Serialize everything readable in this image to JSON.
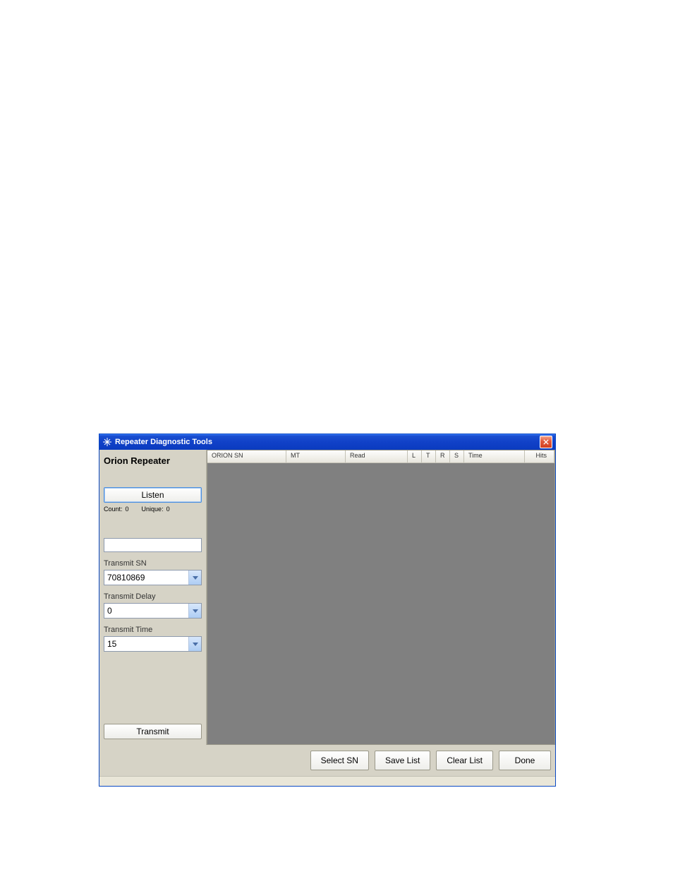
{
  "window": {
    "title": "Repeater Diagnostic Tools"
  },
  "sidebar": {
    "title": "Orion Repeater",
    "listen_label": "Listen",
    "count_label": "Count:",
    "count_value": "0",
    "unique_label": "Unique:",
    "unique_value": "0",
    "search_value": "",
    "transmit_sn_label": "Transmit SN",
    "transmit_sn_value": "70810869",
    "transmit_delay_label": "Transmit Delay",
    "transmit_delay_value": "0",
    "transmit_time_label": "Transmit Time",
    "transmit_time_value": "15",
    "transmit_label": "Transmit"
  },
  "columns": {
    "orion_sn": "ORION SN",
    "mt": "MT",
    "read": "Read",
    "l": "L",
    "t": "T",
    "r": "R",
    "s": "S",
    "time": "Time",
    "hits": "Hits"
  },
  "buttons": {
    "select_sn": "Select SN",
    "save_list": "Save List",
    "clear_list": "Clear List",
    "done": "Done"
  }
}
